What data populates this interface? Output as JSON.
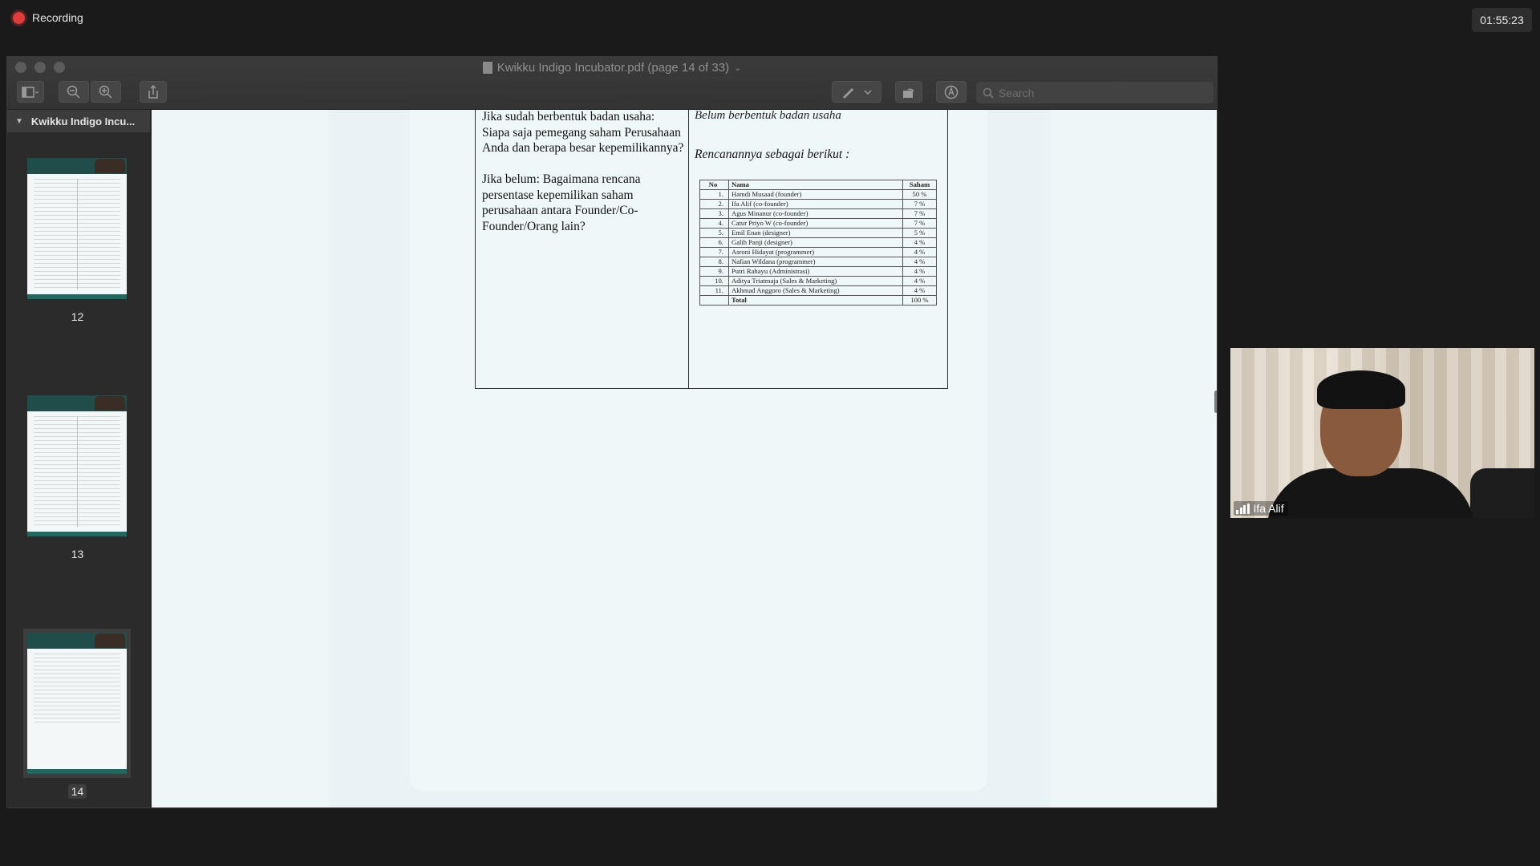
{
  "meeting": {
    "recording_label": "Recording",
    "elapsed_time": "01:55:23"
  },
  "preview": {
    "window_title": "Kwikku Indigo Incubator.pdf (page 14 of 33)",
    "title_menu_icon": "chevron-down-icon",
    "search_placeholder": "Search",
    "sidebar_title": "Kwikku Indigo Incu...",
    "thumbnails": [
      {
        "page": "12"
      },
      {
        "page": "13"
      },
      {
        "page": "14",
        "selected": true
      }
    ]
  },
  "document": {
    "question_1": "Jika sudah berbentuk badan usaha: Siapa saja pemegang saham Perusahaan Anda dan berapa besar kepemilikannya?",
    "question_2": "Jika belum: Bagaimana rencana persentase kepemilikan saham perusahaan antara Founder/Co-Founder/Orang lain?",
    "answer_1": "Belum berbentuk badan usaha",
    "answer_2": "Rencanannya sebagai berikut :",
    "share_table": {
      "headers": [
        "No",
        "Nama",
        "Saham"
      ],
      "rows": [
        [
          "1.",
          "Hamdi Musaad (founder)",
          "50 %"
        ],
        [
          "2.",
          "Ifa Alif (co-founder)",
          "7 %"
        ],
        [
          "3.",
          "Agus Minanur (co-founder)",
          "7 %"
        ],
        [
          "4.",
          "Catur Priyo W (co-founder)",
          "7 %"
        ],
        [
          "5.",
          "Emil Enan (designer)",
          "5 %"
        ],
        [
          "6.",
          "Galih Panji (designer)",
          "4 %"
        ],
        [
          "7.",
          "Asroni Hidayat (programmer)",
          "4 %"
        ],
        [
          "8.",
          "Nafian Wildana (programmer)",
          "4 %"
        ],
        [
          "9.",
          "Putri Rahayu (Administrasi)",
          "4 %"
        ],
        [
          "10.",
          "Aditya Triatmaja (Sales & Marketing)",
          "4 %"
        ],
        [
          "11.",
          "Akhmad Anggoro (Sales & Marketing)",
          "4 %"
        ]
      ],
      "total_label": "Total",
      "total_value": "100 %"
    }
  },
  "participant": {
    "name": "Ifa Alif",
    "signal_icon": "signal-bars-icon"
  }
}
